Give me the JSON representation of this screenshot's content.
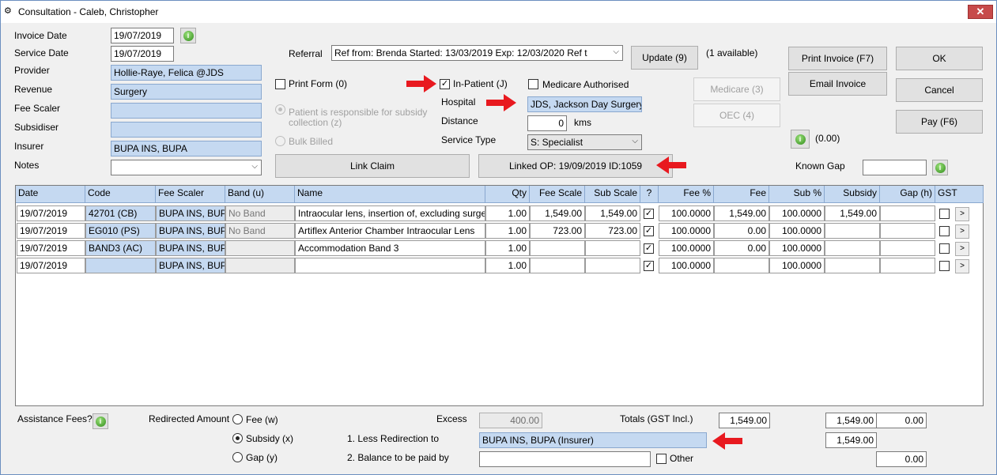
{
  "window": {
    "title": "Consultation - Caleb, Christopher",
    "close_label": "✕"
  },
  "header": {
    "invoice_date_label": "Invoice Date",
    "invoice_date": "19/07/2019",
    "service_date_label": "Service Date",
    "service_date": "19/07/2019",
    "provider_label": "Provider",
    "provider": "Hollie-Raye, Felica @JDS",
    "revenue_label": "Revenue",
    "revenue": "Surgery",
    "fee_scaler_label": "Fee Scaler",
    "fee_scaler": "",
    "subsidiser_label": "Subsidiser",
    "subsidiser": "",
    "insurer_label": "Insurer",
    "insurer": "BUPA INS, BUPA",
    "notes_label": "Notes",
    "notes": ""
  },
  "referral": {
    "label": "Referral",
    "value": "Ref from:        Brenda  Started:  13/03/2019  Exp:  12/03/2020  Ref t",
    "update_button": "Update (9)",
    "available": "(1 available)"
  },
  "options": {
    "print_form": "Print Form (0)",
    "print_form_checked": false,
    "in_patient": "In-Patient (J)",
    "in_patient_checked": true,
    "medicare_authorised": "Medicare Authorised",
    "medicare_authorised_checked": false,
    "patient_responsible": "Patient is responsible for subsidy collection (z)",
    "bulk_billed": "Bulk Billed",
    "hospital_label": "Hospital",
    "hospital": "JDS, Jackson Day Surgery",
    "distance_label": "Distance",
    "distance": "0",
    "distance_unit": "kms",
    "service_type_label": "Service Type",
    "service_type": "S: Specialist",
    "link_claim": "Link Claim",
    "linked_op": "Linked OP: 19/09/2019 ID:1059"
  },
  "right_buttons": {
    "print_invoice": "Print Invoice (F7)",
    "email_invoice": "Email Invoice",
    "ok": "OK",
    "cancel": "Cancel",
    "pay": "Pay (F6)",
    "medicare": "Medicare (3)",
    "oec": "OEC (4)",
    "credit_amount": "(0.00)",
    "known_gap_label": "Known Gap",
    "known_gap": ""
  },
  "table": {
    "headers": [
      "Date",
      "Code",
      "Fee Scaler",
      "Band (u)",
      "Name",
      "Qty",
      "Fee Scale",
      "Sub Scale",
      "?",
      "Fee %",
      "Fee",
      "Sub %",
      "Subsidy",
      "Gap (h)",
      "GST"
    ],
    "rows": [
      {
        "date": "19/07/2019",
        "code": "42701 (CB)",
        "fee_scaler": "BUPA INS, BUPA",
        "band": "No Band",
        "name": "Intraocular lens, insertion of, excluding surgery per",
        "qty": "1.00",
        "fee_scale": "1,549.00",
        "sub_scale": "1,549.00",
        "fee_pct": "100.0000",
        "fee": "1,549.00",
        "sub_pct": "100.0000",
        "subsidy": "1,549.00",
        "gap": ""
      },
      {
        "date": "19/07/2019",
        "code": "EG010 (PS)",
        "fee_scaler": "BUPA INS, BUPA",
        "band": "No Band",
        "name": "Artiflex Anterior Chamber Intraocular Lens",
        "qty": "1.00",
        "fee_scale": "723.00",
        "sub_scale": "723.00",
        "fee_pct": "100.0000",
        "fee": "0.00",
        "sub_pct": "100.0000",
        "subsidy": "",
        "gap": ""
      },
      {
        "date": "19/07/2019",
        "code": "BAND3 (AC)",
        "fee_scaler": "BUPA INS, BUPA",
        "band": "",
        "name": "Accommodation Band 3",
        "qty": "1.00",
        "fee_scale": "",
        "sub_scale": "",
        "fee_pct": "100.0000",
        "fee": "0.00",
        "sub_pct": "100.0000",
        "subsidy": "",
        "gap": ""
      },
      {
        "date": "19/07/2019",
        "code": "",
        "fee_scaler": "BUPA INS, BUPA",
        "band": "",
        "name": "",
        "qty": "1.00",
        "fee_scale": "",
        "sub_scale": "",
        "fee_pct": "100.0000",
        "fee": "",
        "sub_pct": "100.0000",
        "subsidy": "",
        "gap": ""
      }
    ],
    "row_button": ">"
  },
  "footer": {
    "assistance_fees": "Assistance Fees?",
    "redirected_amount": "Redirected Amount",
    "fee_w": "Fee (w)",
    "subsidy_x": "Subsidy (x)",
    "gap_y": "Gap (y)",
    "excess_label": "Excess",
    "excess": "400.00",
    "totals_label": "Totals (GST Incl.)",
    "total_fee": "1,549.00",
    "total_subsidy": "1,549.00",
    "total_gap": "0.00",
    "less_redirection_label": "1. Less Redirection to",
    "less_redirection": "BUPA INS, BUPA (Insurer)",
    "less_redirection_amount": "1,549.00",
    "balance_label": "2. Balance to be paid by",
    "balance_payer": "",
    "other": "Other",
    "balance_amount": "0.00"
  },
  "colors": {
    "selection_blue": "#c5d9f1",
    "arrow_red": "#e8191f"
  }
}
